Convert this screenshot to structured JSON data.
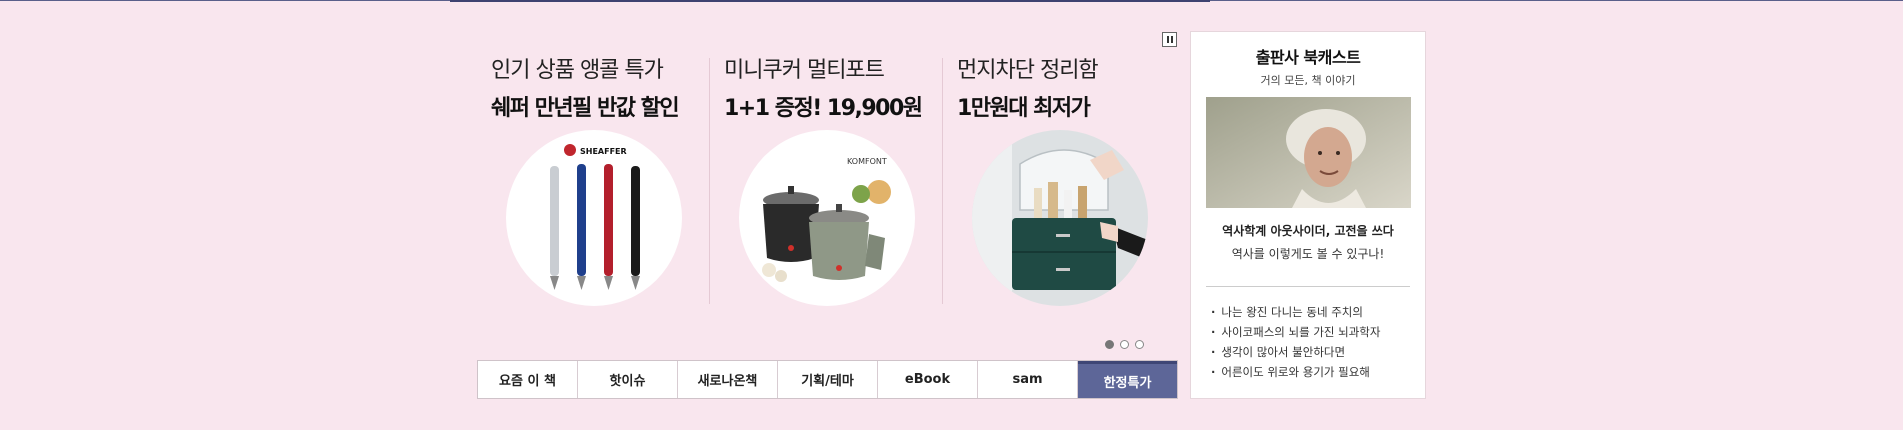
{
  "promos": [
    {
      "line1": "인기 상품 앵콜 특가",
      "line2": "쉐퍼 만년필 반값 할인",
      "brand": "SHEAFFER"
    },
    {
      "line1": "미니쿠커 멀티포트",
      "line2": " 1+1 증정! 19,900원",
      "brand": "KOMFONT"
    },
    {
      "line1": "먼지차단 정리함",
      "line2": "1만원대 최저가"
    }
  ],
  "controls": {
    "pause_icon": "pause-icon",
    "page_count": 3,
    "active_page": 1
  },
  "tabs": [
    {
      "label": "요즘 이 책"
    },
    {
      "label": "핫이슈"
    },
    {
      "label": "새로나온책"
    },
    {
      "label": "기획/테마"
    },
    {
      "label": "eBook"
    },
    {
      "label": "sam"
    },
    {
      "label": "한정특가",
      "active": true
    }
  ],
  "sidebar": {
    "title": "출판사 북캐스트",
    "subtitle": "거의 모든, 책 이야기",
    "feature_title": "역사학계 아웃사이더, 고전을 쓰다",
    "feature_desc": "역사를 이렇게도 볼 수 있구나!",
    "items": [
      "나는 왕진 다니는 동네 주치의",
      "사이코패스의 뇌를 가진 뇌과학자",
      "생각이 많아서 불안하다면",
      "어른이도 위로와 용기가 필요해"
    ]
  },
  "colors": {
    "background": "#f9e6ee",
    "active_tab": "#5d6698",
    "divider": "#e5c9d4"
  }
}
